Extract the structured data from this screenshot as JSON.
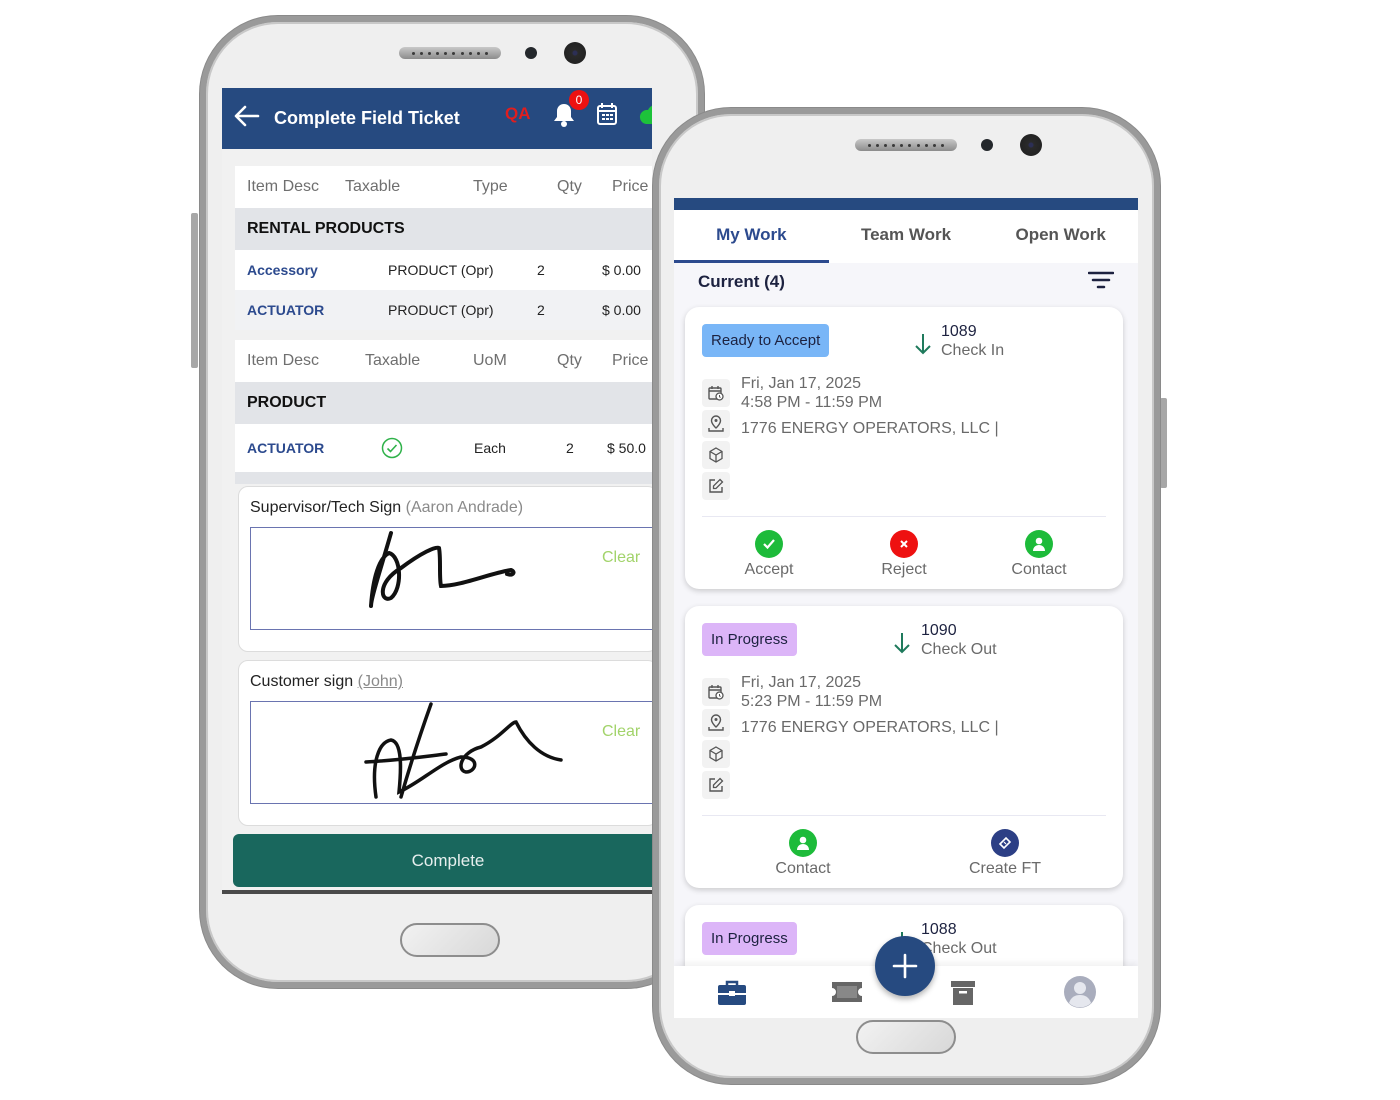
{
  "left_phone": {
    "header": {
      "title": "Complete Field Ticket",
      "env_label": "QA",
      "notification_count": "0",
      "cloud_status_color": "#1dc23a"
    },
    "rental_table": {
      "columns": [
        "Item Desc",
        "Taxable",
        "Type",
        "Qty",
        "Price"
      ],
      "group": "RENTAL PRODUCTS",
      "rows": [
        {
          "item": "Accessory",
          "type": "PRODUCT (Opr)",
          "qty": "2",
          "price": "$ 0.00"
        },
        {
          "item": "ACTUATOR",
          "type": "PRODUCT (Opr)",
          "qty": "2",
          "price": "$ 0.00"
        }
      ]
    },
    "product_table": {
      "columns": [
        "Item Desc",
        "Taxable",
        "UoM",
        "Qty",
        "Price"
      ],
      "group": "PRODUCT",
      "rows": [
        {
          "item": "ACTUATOR",
          "taxable": true,
          "uom": "Each",
          "qty": "2",
          "price": "$ 50.0"
        }
      ]
    },
    "supervisor_sign": {
      "label": "Supervisor/Tech Sign",
      "name": "(Aaron Andrade)",
      "clear_label": "Clear"
    },
    "customer_sign": {
      "label": "Customer sign",
      "name": "(John)",
      "clear_label": "Clear"
    },
    "complete_label": "Complete"
  },
  "right_phone": {
    "tabs": [
      {
        "label": "My Work",
        "active": true
      },
      {
        "label": "Team Work",
        "active": false
      },
      {
        "label": "Open Work",
        "active": false
      }
    ],
    "section_title": "Current (4)",
    "cards": [
      {
        "status": "Ready to Accept",
        "status_color": "#79b6f7",
        "ticket_no": "1089",
        "action": "Check In",
        "date": "Fri, Jan 17, 2025",
        "time": "4:58 PM - 11:59 PM",
        "location": "1776 ENERGY OPERATORS, LLC |",
        "actions": [
          {
            "label": "Accept",
            "icon": "check-icon",
            "color": "#1dbb3a"
          },
          {
            "label": "Reject",
            "icon": "close-icon",
            "color": "#ee1111"
          },
          {
            "label": "Contact",
            "icon": "person-icon",
            "color": "#1dbb3a"
          }
        ]
      },
      {
        "status": "In Progress",
        "status_color": "#dcb5f8",
        "ticket_no": "1090",
        "action": "Check Out",
        "date": "Fri, Jan 17, 2025",
        "time": "5:23 PM - 11:59 PM",
        "location": "1776 ENERGY OPERATORS, LLC |",
        "actions": [
          {
            "label": "Contact",
            "icon": "person-icon",
            "color": "#1dbb3a"
          },
          {
            "label": "Create FT",
            "icon": "ticket-icon",
            "color": "#2c3f85"
          }
        ]
      },
      {
        "status": "In Progress",
        "status_color": "#dcb5f8",
        "ticket_no": "1088",
        "action": "Check Out"
      }
    ],
    "bottom_nav": [
      "briefcase-icon",
      "ticket-icon",
      "archive-icon",
      "profile-icon"
    ]
  }
}
